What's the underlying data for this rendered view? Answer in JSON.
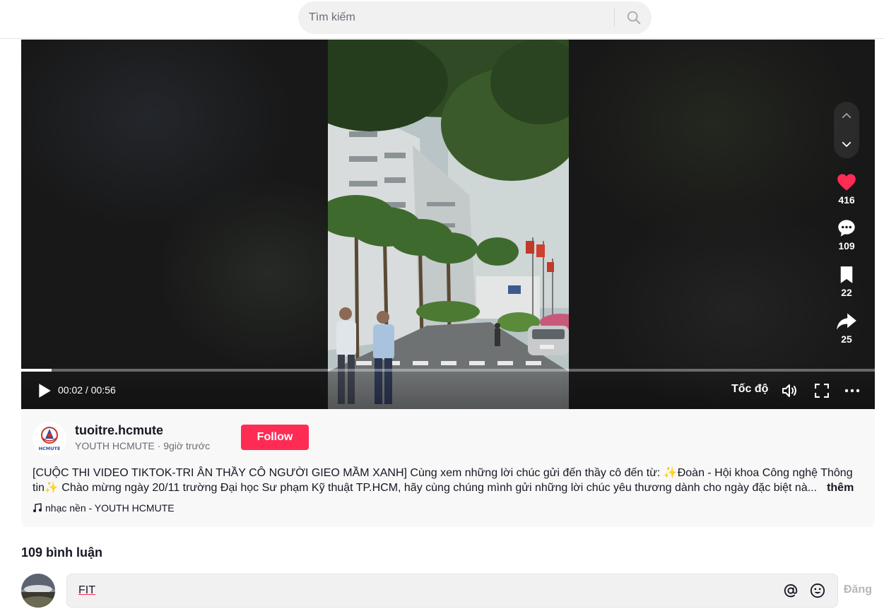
{
  "header": {
    "search_placeholder": "Tìm kiếm",
    "search_icon": "search-icon"
  },
  "video": {
    "current_time": "00:02",
    "duration": "00:56",
    "time_display": "00:02 / 00:56",
    "progress_fraction": 0.036,
    "speed_label": "Tốc độ",
    "icons": [
      "play-icon",
      "volume-icon",
      "fullscreen-icon",
      "more-icon"
    ]
  },
  "actions": {
    "likes": "416",
    "comments": "109",
    "saves": "22",
    "shares": "25",
    "like_color": "#fe2c55"
  },
  "author": {
    "username": "tuoitre.hcmute",
    "display_name": "YOUTH HCMUTE",
    "posted": "9giờ trước",
    "meta": "YOUTH HCMUTE · 9giờ trước",
    "avatar_text": "HCMUTE",
    "follow_label": "Follow"
  },
  "description": {
    "text": "[CUỘC THI VIDEO TIKTOK-TRI ÂN THẦY CÔ NGƯỜI GIEO MẦM XANH] Cùng xem những lời chúc gửi đến thầy cô đến từ: ✨Đoàn - Hội khoa Công nghệ Thông tin✨ Chào mừng ngày 20/11 trường Đại học Sư phạm Kỹ thuật TP.HCM, hãy cùng chúng mình gửi những lời chúc yêu thương dành cho ngày đặc biệt nà...",
    "more_label": "thêm"
  },
  "music": {
    "label": "nhạc nền - YOUTH HCMUTE"
  },
  "comments": {
    "title": "109 bình luận",
    "input_value": "FIT",
    "post_label": "Đăng"
  },
  "colors": {
    "accent": "#fe2c55",
    "bg_panel": "#f8f8f8"
  }
}
